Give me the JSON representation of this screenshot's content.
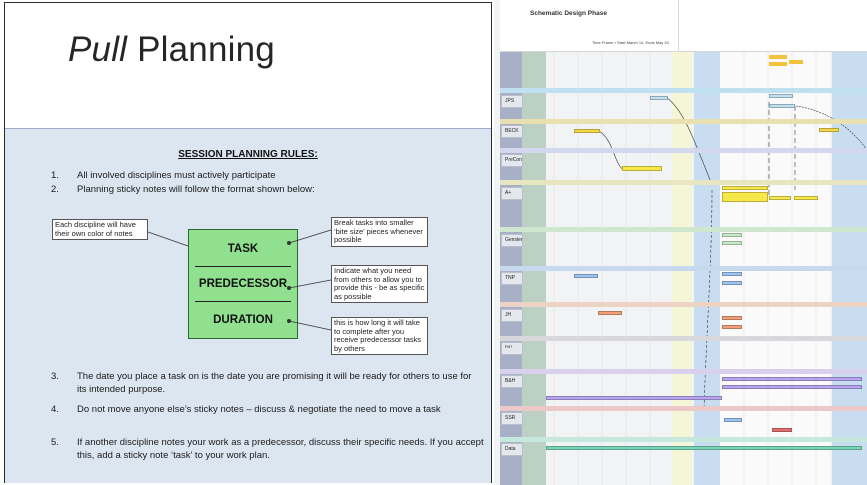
{
  "slide": {
    "title_italic": "Pull",
    "title_rest": " Planning",
    "rules_heading": "SESSION PLANNING RULES:",
    "rules": [
      {
        "num": "1.",
        "text": "All involved disciplines must actively participate"
      },
      {
        "num": "2.",
        "text": "Planning sticky notes will follow the format shown below:"
      },
      {
        "num": "3.",
        "text": "The date you place a task on is the date you are promising it will be ready for others to use for its intended purpose."
      },
      {
        "num": "4.",
        "text": "Do not move anyone else’s sticky notes – discuss & negotiate the need to move a task"
      },
      {
        "num": "5.",
        "text": "If another discipline notes your work as a predecessor, discuss their specific needs.  If you accept this, add a sticky note ‘task’ to your work plan."
      }
    ],
    "sticky": {
      "task": "TASK",
      "predecessor": "PREDECESSOR",
      "duration": "DURATION",
      "color": "#90e08f"
    },
    "callouts": {
      "discipline_color": "Each discipline will have their own color of notes",
      "task_size": "Break tasks into smaller ‘bite size’ pieces whenever possible",
      "predecessor_info": "Indicate what you need from others to allow you to provide this - be as specific as possible",
      "duration_info": "this is how long it will take to complete after you receive predecessor tasks by others"
    }
  },
  "board": {
    "phase_title": "Schematic Design Phase",
    "timeframe": "Time Frame • Start March 14, Ends May 20",
    "rows": [
      {
        "label": "JPS",
        "color": "#bfe0f0"
      },
      {
        "label": "BECK",
        "color": "#f5d84a"
      },
      {
        "label": "PreCon",
        "color": "#c9d3f0"
      },
      {
        "label": "A+",
        "color": "#f7e84a"
      },
      {
        "label": "Gensler",
        "color": "#c8ebc8"
      },
      {
        "label": "TNP",
        "color": "#9dc3f0"
      },
      {
        "label": "JH",
        "color": "#f2a07a"
      },
      {
        "label": "PMT",
        "color": "#c9c9c9"
      },
      {
        "label": "B&H",
        "color": "#b9a6f0"
      },
      {
        "label": "SSR",
        "color": "#e27070"
      },
      {
        "label": "Data",
        "color": "#77d6b8"
      }
    ]
  }
}
